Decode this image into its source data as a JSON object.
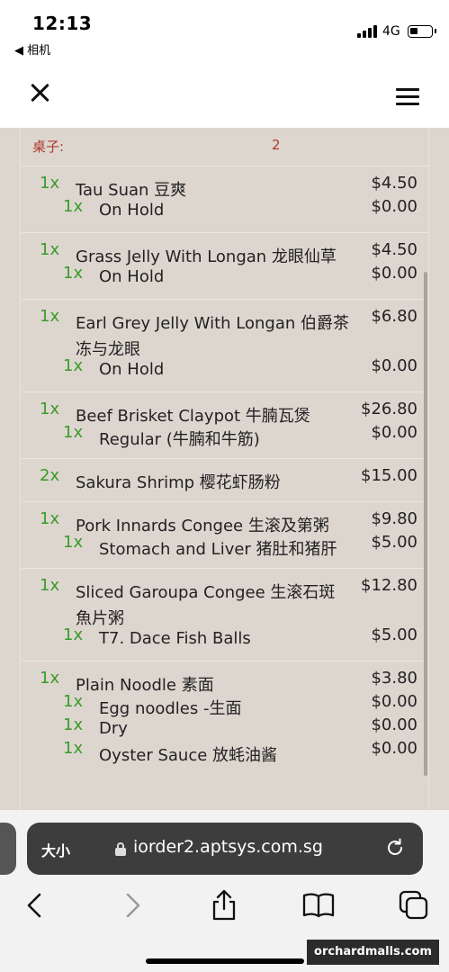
{
  "status_bar": {
    "time": "12:13",
    "back_app": "◀ 相机",
    "network": "4G"
  },
  "table": {
    "label": "桌子:",
    "number": "2"
  },
  "order_groups": [
    {
      "lines": [
        {
          "qty": "1x",
          "name": "Tau Suan 豆爽",
          "price": "$4.50",
          "level": 0
        },
        {
          "qty": "1x",
          "name": "On Hold",
          "price": "$0.00",
          "level": 1
        }
      ]
    },
    {
      "lines": [
        {
          "qty": "1x",
          "name": "Grass Jelly With Longan 龙眼仙草",
          "price": "$4.50",
          "level": 0
        },
        {
          "qty": "1x",
          "name": "On Hold",
          "price": "$0.00",
          "level": 1
        }
      ]
    },
    {
      "lines": [
        {
          "qty": "1x",
          "name": "Earl Grey Jelly With Longan 伯爵茶",
          "name2": "冻与龙眼",
          "price": "$6.80",
          "level": 0
        },
        {
          "qty": "1x",
          "name": "On Hold",
          "price": "$0.00",
          "level": 1
        }
      ]
    },
    {
      "lines": [
        {
          "qty": "1x",
          "name": "Beef Brisket Claypot 牛腩瓦煲",
          "price": "$26.80",
          "level": 0
        },
        {
          "qty": "1x",
          "name": "Regular (牛腩和牛筋)",
          "price": "$0.00",
          "level": 1
        }
      ]
    },
    {
      "lines": [
        {
          "qty": "2x",
          "name": "Sakura Shrimp 樱花虾肠粉",
          "price": "$15.00",
          "level": 0
        }
      ]
    },
    {
      "lines": [
        {
          "qty": "1x",
          "name": "Pork Innards Congee 生滚及第粥",
          "price": "$9.80",
          "level": 0
        },
        {
          "qty": "1x",
          "name": "Stomach and Liver 猪肚和猪肝",
          "price": "$5.00",
          "level": 1
        }
      ]
    },
    {
      "lines": [
        {
          "qty": "1x",
          "name": "Sliced Garoupa Congee 生滚石斑",
          "name2": "魚片粥",
          "price": "$12.80",
          "level": 0
        },
        {
          "qty": "1x",
          "name": "T7. Dace Fish Balls",
          "price": "$5.00",
          "level": 1
        }
      ]
    },
    {
      "lines": [
        {
          "qty": "1x",
          "name": "Plain Noodle 素面",
          "price": "$3.80",
          "level": 0
        },
        {
          "qty": "1x",
          "name": "Egg noodles -生面",
          "price": "$0.00",
          "level": 1
        },
        {
          "qty": "1x",
          "name": "Dry",
          "price": "$0.00",
          "level": 1
        },
        {
          "qty": "1x",
          "name": "Oyster Sauce 放蚝油酱",
          "price": "$0.00",
          "level": 1
        }
      ]
    }
  ],
  "browser": {
    "text_size": "大小",
    "url": "iorder2.aptsys.com.sg"
  },
  "watermark": "orchardmalls.com",
  "colors": {
    "qty_green": "#3a9a2a",
    "table_red": "#b03a2e",
    "content_bg": "#ddd6cf"
  }
}
